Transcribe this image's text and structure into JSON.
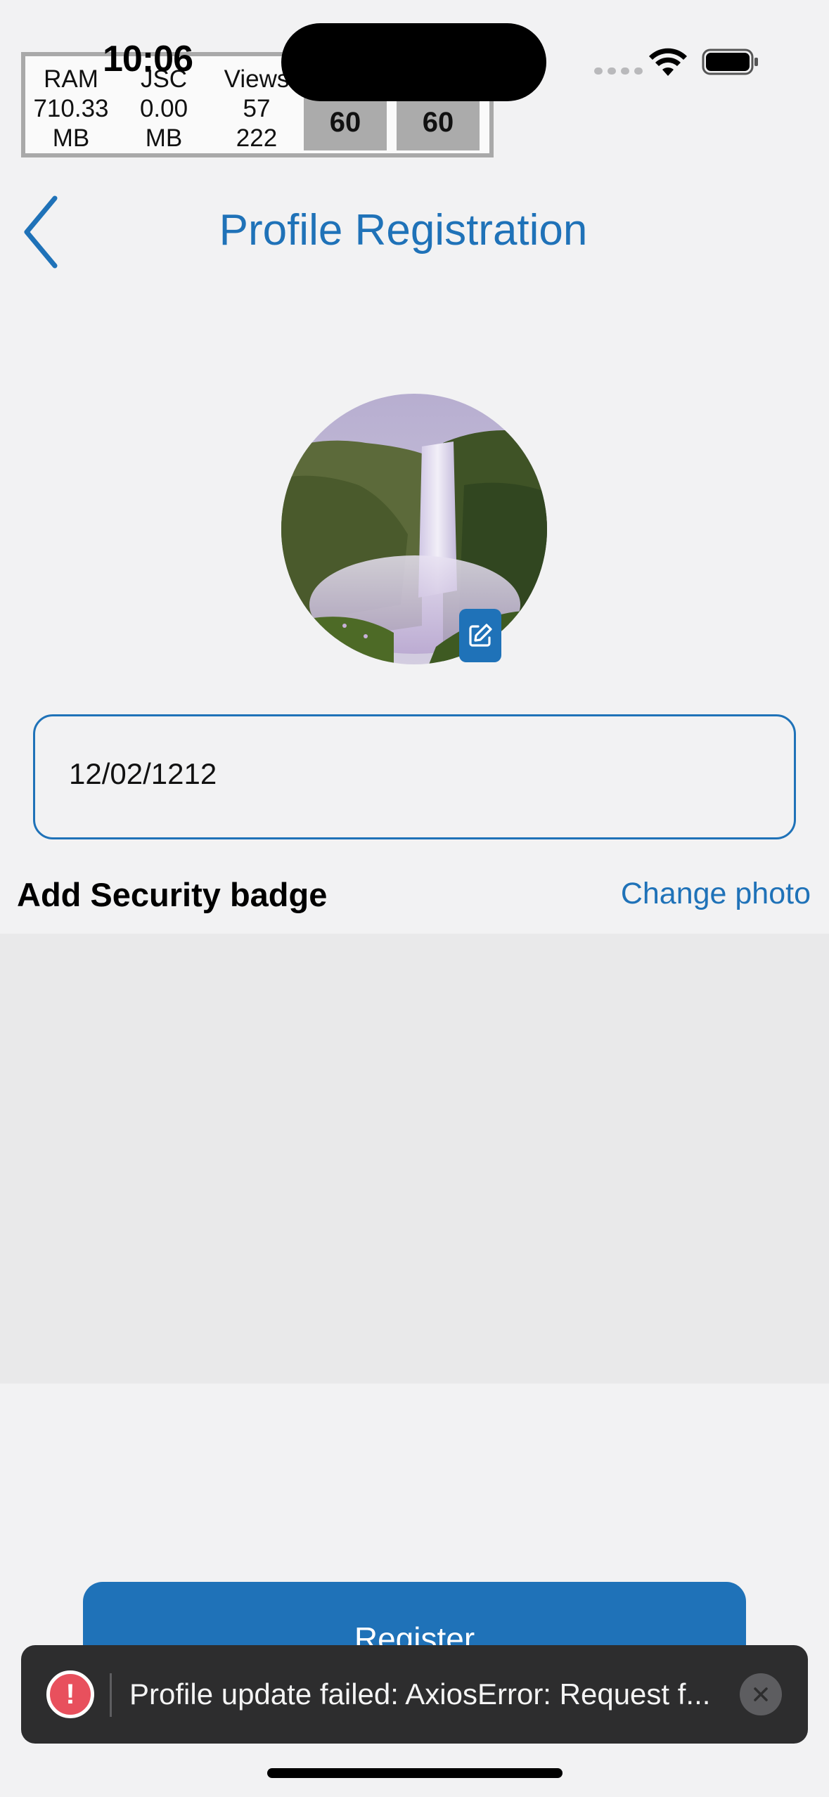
{
  "status_bar": {
    "time": "10:06"
  },
  "perf_monitor": {
    "ram_label": "RAM",
    "ram_value": "710.33",
    "ram_unit": "MB",
    "jsc_label": "JSC",
    "jsc_value": "0.00",
    "jsc_unit": "MB",
    "views_label": "Views",
    "views_value": "57",
    "views_value2": "222",
    "fps_ui": "60",
    "fps_js": "60"
  },
  "header": {
    "title": "Profile Registration",
    "back_icon": "chevron-left-icon"
  },
  "profile": {
    "avatar_icon": "waterfall-photo",
    "edit_icon": "edit-icon"
  },
  "form": {
    "date_value": "12/02/1212"
  },
  "security_badge": {
    "title": "Add Security badge",
    "change_photo": "Change photo"
  },
  "actions": {
    "register": "Register"
  },
  "toast": {
    "message": "Profile update failed: AxiosError: Request f...",
    "icon": "!"
  },
  "colors": {
    "accent": "#1f72b8",
    "background": "#f2f2f3",
    "toast_bg": "#2d2d2e",
    "error": "#e8505d"
  }
}
